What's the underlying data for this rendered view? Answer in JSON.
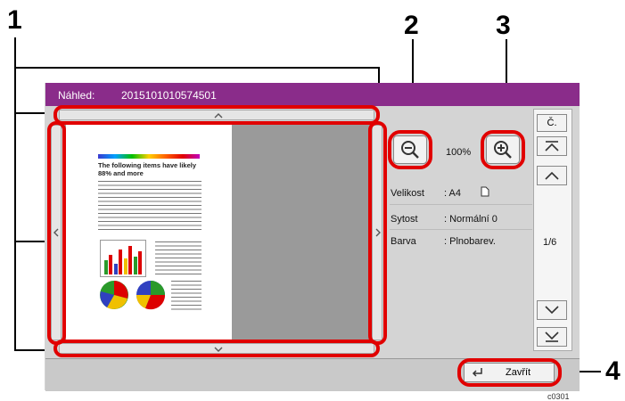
{
  "callouts": {
    "c1": "1",
    "c2": "2",
    "c3": "3",
    "c4": "4"
  },
  "titlebar": {
    "label": "Náhled:",
    "filename": "2015101010574501"
  },
  "zoom": {
    "value": "100%"
  },
  "info": {
    "size_key": "Velikost",
    "size_val": ": A4",
    "density_key": "Sytost",
    "density_val": ": Normální 0",
    "color_key": "Barva",
    "color_val": ": Plnobarev."
  },
  "nav": {
    "first_label": "Č.",
    "page": "1/6"
  },
  "close_label": "Zavřít",
  "doc": {
    "heading": "The following items have likely 88% and more",
    "caption": "c0301"
  },
  "colors": {
    "accent": "#e10000",
    "titlebar": "#8a2c8a"
  },
  "icons": [
    "zoom-out-icon",
    "zoom-in-icon",
    "first-page-icon",
    "page-up-icon",
    "page-down-icon",
    "last-page-icon",
    "return-arrow-icon",
    "portrait-page-icon"
  ]
}
